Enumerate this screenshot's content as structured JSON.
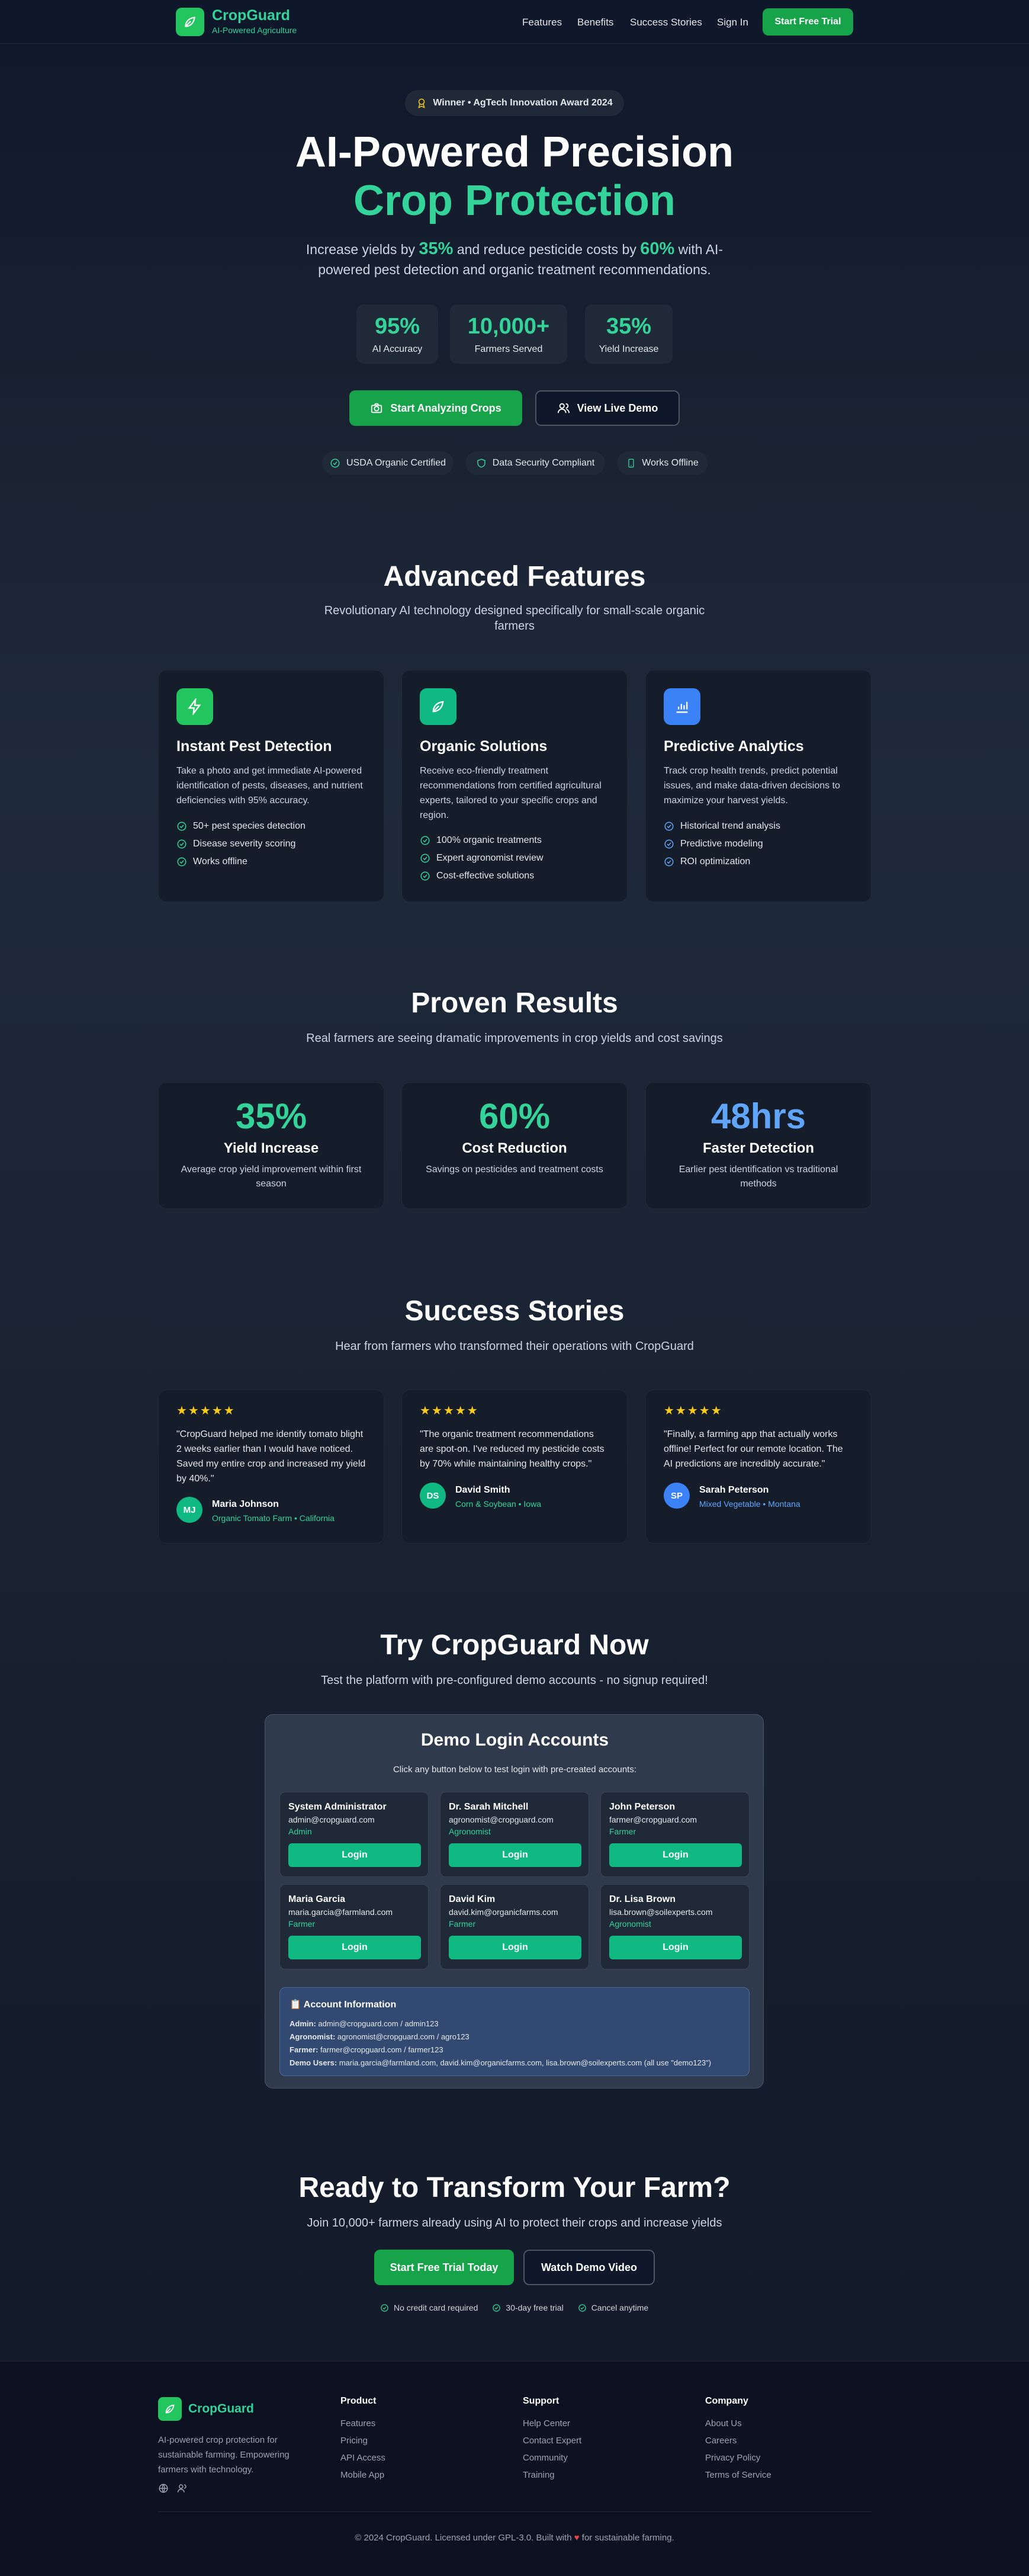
{
  "nav": {
    "brand": "CropGuard",
    "tagline": "AI-Powered Agriculture",
    "links": [
      "Features",
      "Benefits",
      "Success Stories",
      "Sign In"
    ],
    "cta": "Start Free Trial"
  },
  "hero": {
    "award": "Winner • AgTech Innovation Award 2024",
    "title_line1": "AI-Powered Precision",
    "title_line2": "Crop Protection",
    "desc_a": "Increase yields by ",
    "desc_b": "35%",
    "desc_c": " and reduce pesticide costs by ",
    "desc_d": "60%",
    "desc_e": " with AI-",
    "desc_line2": "powered pest detection and organic treatment recommendations.",
    "stats": [
      {
        "value": "95%",
        "label": "AI Accuracy"
      },
      {
        "value": "10,000+",
        "label": "Farmers Served"
      },
      {
        "value": "35%",
        "label": "Yield Increase"
      }
    ],
    "primary_cta": "Start Analyzing Crops",
    "secondary_cta": "View Live Demo",
    "badges": [
      "USDA Organic Certified",
      "Data Security Compliant",
      "Works Offline"
    ]
  },
  "features": {
    "title": "Advanced Features",
    "subtitle_line1": "Revolutionary AI technology designed specifically for small-scale organic",
    "subtitle_line2": "farmers",
    "cards": [
      {
        "title": "Instant Pest Detection",
        "lines": [
          "Take a photo and get immediate AI-powered",
          "identification of pests, diseases, and nutrient",
          "deficiencies with 95% accuracy."
        ],
        "items": [
          "50+ pest species detection",
          "Disease severity scoring",
          "Works offline"
        ]
      },
      {
        "title": "Organic Solutions",
        "lines": [
          "Receive eco-friendly treatment",
          "recommendations from certified agricultural",
          "experts, tailored to your specific crops and",
          "region."
        ],
        "items": [
          "100% organic treatments",
          "Expert agronomist review",
          "Cost-effective solutions"
        ]
      },
      {
        "title": "Predictive Analytics",
        "lines": [
          "Track crop health trends, predict potential",
          "issues, and make data-driven decisions to",
          "maximize your harvest yields."
        ],
        "items": [
          "Historical trend analysis",
          "Predictive modeling",
          "ROI optimization"
        ]
      }
    ]
  },
  "results": {
    "title": "Proven Results",
    "subtitle": "Real farmers are seeing dramatic improvements in crop yields and cost savings",
    "cards": [
      {
        "value": "35%",
        "title": "Yield Increase",
        "lines": [
          "Average crop yield improvement within first",
          "season"
        ],
        "color": "#34d399"
      },
      {
        "value": "60%",
        "title": "Cost Reduction",
        "lines": [
          "Savings on pesticides and treatment costs"
        ],
        "color": "#34d399"
      },
      {
        "value": "48hrs",
        "title": "Faster Detection",
        "lines": [
          "Earlier pest identification vs traditional",
          "methods"
        ],
        "color": "#60a5fa"
      }
    ]
  },
  "stories": {
    "title": "Success Stories",
    "subtitle": "Hear from farmers who transformed their operations with CropGuard",
    "stars": "★★★★★",
    "items": [
      {
        "lines": [
          "\"CropGuard helped me identify tomato blight",
          "2 weeks earlier than I would have noticed.",
          "Saved my entire crop and increased my yield",
          "by 40%.\""
        ],
        "initials": "MJ",
        "name": "Maria Johnson",
        "farm": "Organic Tomato Farm • California",
        "color": "#10b981"
      },
      {
        "lines": [
          "\"The organic treatment recommendations",
          "are spot-on. I've reduced my pesticide costs",
          "by 70% while maintaining healthy crops.\""
        ],
        "initials": "DS",
        "name": "David Smith",
        "farm": "Corn & Soybean • Iowa",
        "color": "#10b981"
      },
      {
        "lines": [
          "\"Finally, a farming app that actually works",
          "offline! Perfect for our remote location. The",
          "AI predictions are incredibly accurate.\""
        ],
        "initials": "SP",
        "name": "Sarah Peterson",
        "farm": "Mixed Vegetable • Montana",
        "color": "#3b82f6"
      }
    ]
  },
  "demo": {
    "title": "Try CropGuard Now",
    "subtitle": "Test the platform with pre-configured demo accounts - no signup required!",
    "panel_title": "Demo Login Accounts",
    "panel_sub": "Click any button below to test login with pre-created accounts:",
    "button": "Login",
    "accounts": [
      {
        "name": "System Administrator",
        "email": "admin@cropguard.com",
        "role": "Admin"
      },
      {
        "name": "Dr. Sarah Mitchell",
        "email": "agronomist@cropguard.com",
        "role": "Agronomist"
      },
      {
        "name": "John Peterson",
        "email": "farmer@cropguard.com",
        "role": "Farmer"
      },
      {
        "name": "Maria Garcia",
        "email": "maria.garcia@farmland.com",
        "role": "Farmer"
      },
      {
        "name": "David Kim",
        "email": "david.kim@organicfarms.com",
        "role": "Farmer"
      },
      {
        "name": "Dr. Lisa Brown",
        "email": "lisa.brown@soilexperts.com",
        "role": "Agronomist"
      }
    ],
    "info_title": "📋 Account Information",
    "info": [
      {
        "k": "Admin:",
        "v": " admin@cropguard.com / admin123"
      },
      {
        "k": "Agronomist:",
        "v": " agronomist@cropguard.com / agro123"
      },
      {
        "k": "Farmer:",
        "v": " farmer@cropguard.com / farmer123"
      },
      {
        "k": "Demo Users:",
        "v": " maria.garcia@farmland.com, david.kim@organicfarms.com, lisa.brown@soilexperts.com (all use \"demo123\")"
      }
    ]
  },
  "cta": {
    "title": "Ready to Transform Your Farm?",
    "subtitle": "Join 10,000+ farmers already using AI to protect their crops and increase yields",
    "primary": "Start Free Trial Today",
    "secondary": "Watch Demo Video",
    "notes": [
      "No credit card required",
      "30-day free trial",
      "Cancel anytime"
    ]
  },
  "footer": {
    "brand": "CropGuard",
    "desc": [
      "AI-powered crop protection for",
      "sustainable farming. Empowering",
      "farmers with technology."
    ],
    "columns": [
      {
        "title": "Product",
        "links": [
          "Features",
          "Pricing",
          "API Access",
          "Mobile App"
        ]
      },
      {
        "title": "Support",
        "links": [
          "Help Center",
          "Contact Expert",
          "Community",
          "Training"
        ]
      },
      {
        "title": "Company",
        "links": [
          "About Us",
          "Careers",
          "Privacy Policy",
          "Terms of Service"
        ]
      }
    ],
    "copy_a": "© 2024 CropGuard. Licensed under GPL-3.0. Built with ",
    "heart": "♥",
    "copy_b": " for sustainable farming."
  },
  "colors": {
    "green": "#34d399",
    "blue": "#60a5fa",
    "button": "#16a34a"
  }
}
